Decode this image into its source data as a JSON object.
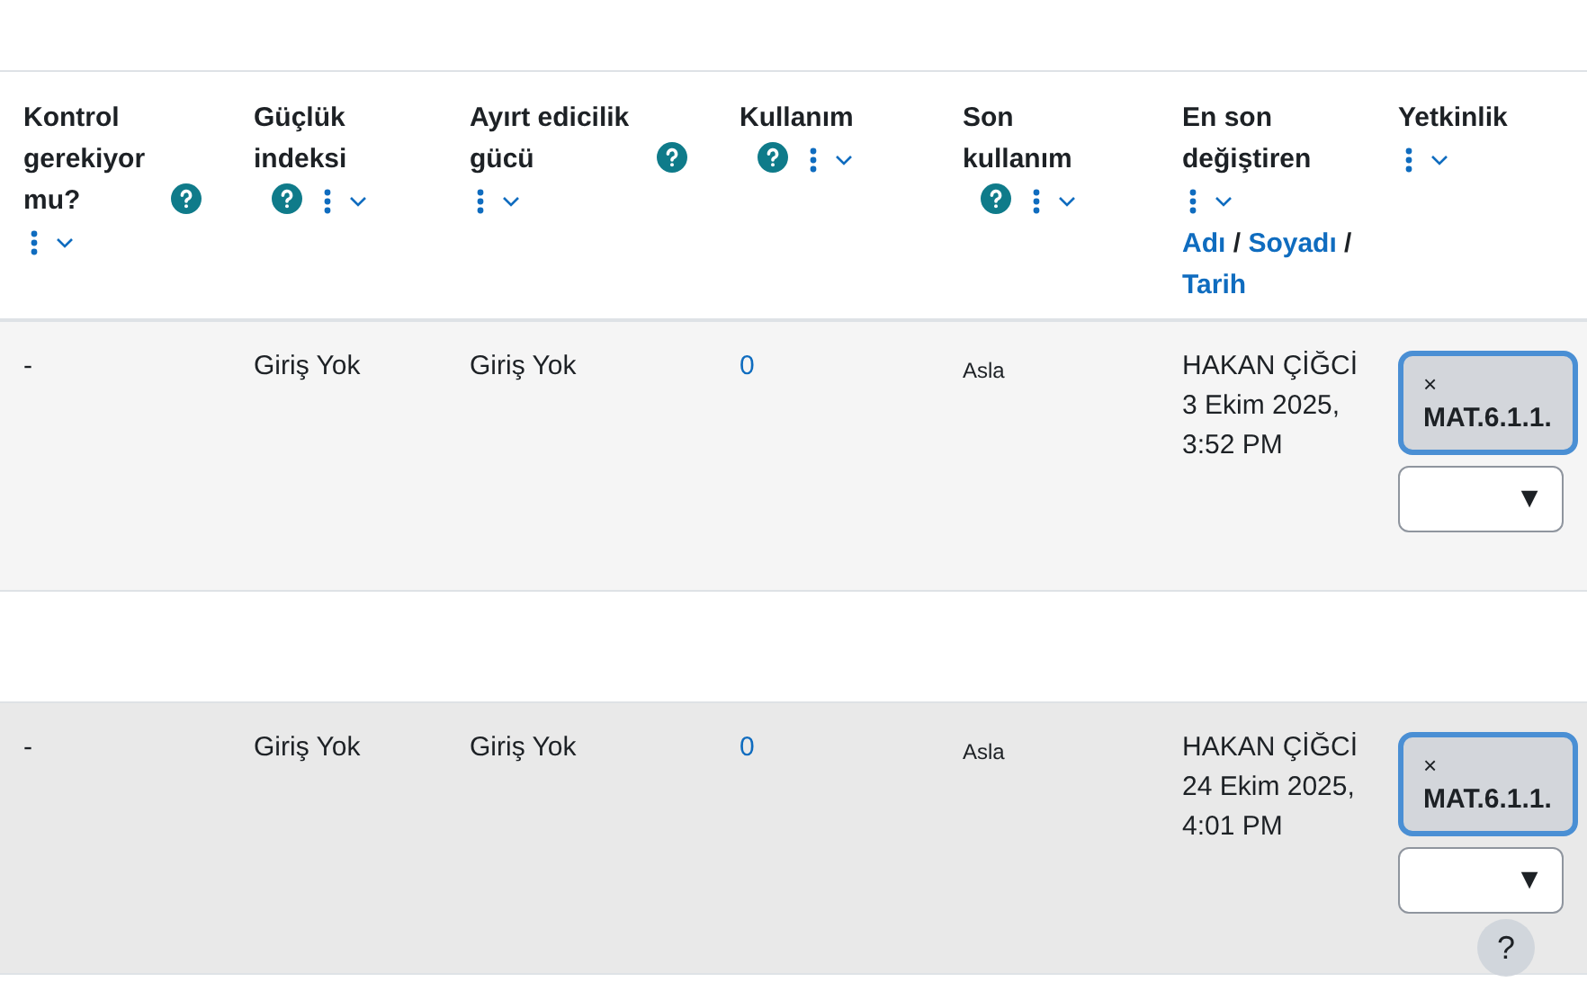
{
  "columns": [
    {
      "title": "Kontrol gerekiyor mu?",
      "help": true
    },
    {
      "title": "Güçlük indeksi",
      "help": true
    },
    {
      "title": "Ayırt edicilik gücü",
      "help": true
    },
    {
      "title": "Kullanım",
      "help": true
    },
    {
      "title": "Son kullanım",
      "help": true
    },
    {
      "title": "En son değiştiren",
      "help": false,
      "sort_links": [
        "Adı",
        "/",
        "Soyadı",
        "/",
        "Tarih"
      ]
    },
    {
      "title": "Yetkinlik",
      "help": false
    }
  ],
  "rows": [
    {
      "highlighted": false,
      "needs_check": "-",
      "difficulty": "Giriş Yok",
      "discrimination": "Giriş Yok",
      "usage": "0",
      "last_used": "Asla",
      "modified_by": {
        "name": "HAKAN ÇİĞCİ",
        "date": "3 Ekim 2025,",
        "time": "3:52 PM"
      },
      "competency": {
        "remove": "×",
        "tag": "MAT.6.1.1.",
        "dropdown_arrow": "▼"
      }
    },
    {
      "highlighted": true,
      "needs_check": "-",
      "difficulty": "Giriş Yok",
      "discrimination": "Giriş Yok",
      "usage": "0",
      "last_used": "Asla",
      "modified_by": {
        "name": "HAKAN ÇİĞCİ",
        "date": "24 Ekim 2025,",
        "time": "4:01 PM"
      },
      "competency": {
        "remove": "×",
        "tag": "MAT.6.1.1.",
        "dropdown_arrow": "▼"
      }
    }
  ],
  "help_button": "?"
}
